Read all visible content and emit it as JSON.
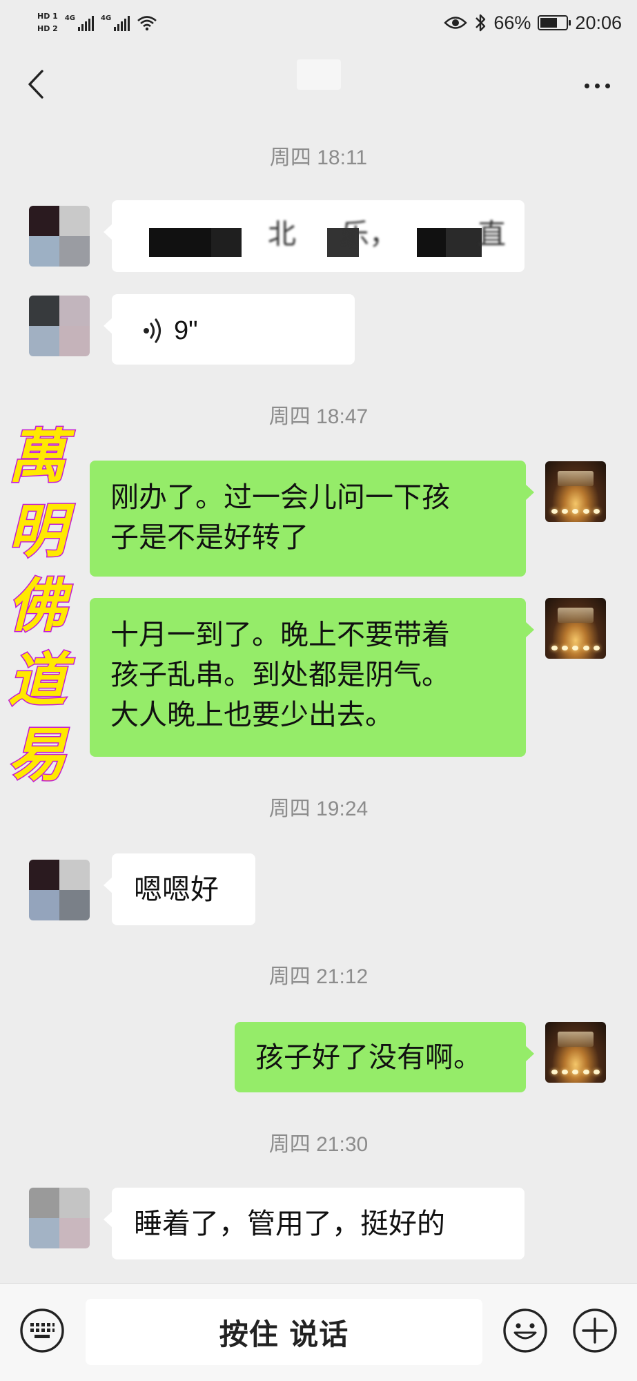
{
  "status_bar": {
    "hd1": "HD 1",
    "hd2": "HD 2",
    "net1": "4G",
    "net2": "4G",
    "battery_text": "66%",
    "battery_level": 0.66,
    "time": "20:06",
    "icons": [
      "eye-icon",
      "bluetooth-icon",
      "wifi-icon",
      "battery-icon"
    ]
  },
  "header": {
    "back_icon": "chevron-left-icon",
    "more_icon": "more-dots-icon"
  },
  "messages": {
    "ts1": "周四 18:11",
    "m1_text_a": "北",
    "m1_text_b": "乐，",
    "m1_text_c": "直",
    "m2_duration": "9\"",
    "ts2": "周四 18:47",
    "m3_text": "刚办了。过一会儿问一下孩\n子是不是好转了",
    "m4_text": "十月一到了。晚上不要带着\n孩子乱串。到处都是阴气。\n大人晚上也要少出去。",
    "ts3": "周四 19:24",
    "m5_text": "嗯嗯好",
    "ts4": "周四 21:12",
    "m6_text": "孩子好了没有啊。",
    "ts5": "周四 21:30",
    "m7_text": "睡着了，管用了，挺好的"
  },
  "watermark": {
    "chars": [
      "萬",
      "明",
      "佛",
      "道",
      "易"
    ]
  },
  "input_bar": {
    "hold_to_talk": "按住 说话",
    "keyboard_icon": "keyboard-icon",
    "emoji_icon": "emoji-icon",
    "plus_icon": "plus-icon"
  },
  "colors": {
    "background": "#ededed",
    "bubble_out": "#95ec69",
    "bubble_in": "#ffffff",
    "watermark_fill": "#ffe900",
    "watermark_stroke": "#c21bd6"
  }
}
